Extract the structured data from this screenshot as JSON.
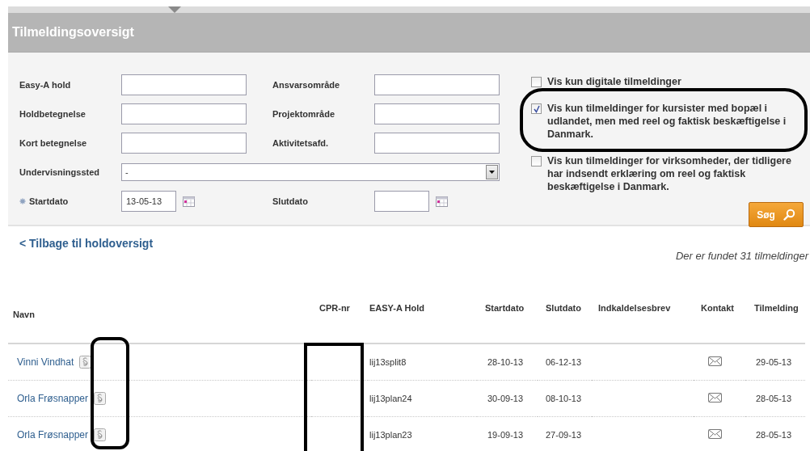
{
  "page_title": "Tilmeldingsoversigt",
  "filters": {
    "fields": [
      {
        "kind": "text",
        "label": "Easy-A hold"
      },
      {
        "kind": "text",
        "label": "Ansvarsområde"
      },
      {
        "kind": "text",
        "label": "Holdbetegnelse"
      },
      {
        "kind": "text",
        "label": "Projektområde"
      },
      {
        "kind": "text",
        "label": "Kort betegnelse"
      },
      {
        "kind": "text",
        "label": "Aktivitetsafd."
      },
      {
        "kind": "select",
        "label": "Undervisningssted",
        "value": "-"
      },
      {
        "kind": "date",
        "label": "Startdato",
        "value": "13-05-13",
        "required": true
      },
      {
        "kind": "date",
        "label": "Slutdato",
        "required": false
      }
    ],
    "options": [
      {
        "label": "Vis kun digitale tilmeldinger",
        "checked": false,
        "circled": false
      },
      {
        "label": "Vis kun tilmeldinger for kursister med bopæl i udlandet, men med reel og faktisk beskæftigelse i Danmark.",
        "checked": true,
        "circled": true
      },
      {
        "label": "Vis kun tilmeldinger for virksomheder, der tidligere har indsendt erklæring om reel og faktisk beskæftigelse i Danmark.",
        "checked": false,
        "circled": false
      }
    ],
    "search_button": "Søg"
  },
  "back_link": "< Tilbage til holdoversigt",
  "result_count": "Der er fundet 31 tilmeldinger",
  "table": {
    "columns": [
      "Navn",
      "CPR-nr",
      "EASY-A Hold",
      "Startdato",
      "Slutdato",
      "Indkaldelsesbrev",
      "Kontakt",
      "Tilmelding"
    ],
    "rows": [
      {
        "name": "Vinni Vindhat",
        "hold": "lij13split8",
        "startdato": "28-10-13",
        "slutdato": "06-12-13",
        "tilmelding": "29-05-13"
      },
      {
        "name": "Orla Frøsnapper",
        "hold": "lij13plan24",
        "startdato": "30-09-13",
        "slutdato": "08-10-13",
        "tilmelding": "28-05-13"
      },
      {
        "name": "Orla Frøsnapper",
        "hold": "lij13plan23",
        "startdato": "19-09-13",
        "slutdato": "27-09-13",
        "tilmelding": "28-05-13"
      }
    ]
  },
  "annotations": {
    "rounded_outline_around_icons": true,
    "box_over_cpr_column": true
  }
}
